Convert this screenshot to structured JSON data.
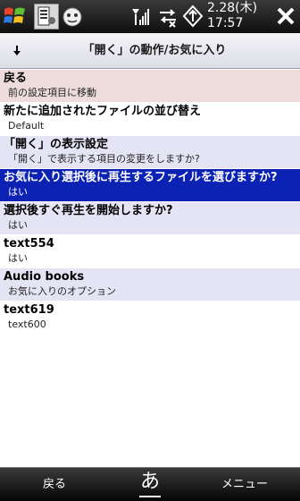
{
  "status": {
    "date": "2.28(木)",
    "time": "17:57"
  },
  "header": {
    "title": "「開く」の動作/お気に入り"
  },
  "colors": {
    "selected": "#0c22b4",
    "row_alt": "#e4e4f4",
    "row_back": "#eedcdc"
  },
  "items": [
    {
      "title": "戻る",
      "subtitle": "前の設定項目に移動"
    },
    {
      "title": "新たに追加されたファイルの並び替え",
      "subtitle": "Default"
    },
    {
      "title": "「開く」の表示設定",
      "subtitle": "「開く」で表示する項目の変更をしますか?"
    },
    {
      "title": "お気に入り選択後に再生するファイルを選びますか?",
      "subtitle": "はい"
    },
    {
      "title": "選択後すぐ再生を開始しますか?",
      "subtitle": "はい"
    },
    {
      "title": "text554",
      "subtitle": "はい"
    },
    {
      "title": "Audio books",
      "subtitle": "お気に入りのオプション"
    },
    {
      "title": "text619",
      "subtitle": "text600"
    }
  ],
  "softkeys": {
    "left": "戻る",
    "ime": "あ",
    "right": "メニュー"
  },
  "icons": [
    "windows-start-icon",
    "settings-app-icon",
    "media-app-icon",
    "signal-icon",
    "sync-icon",
    "data-icon",
    "close-icon",
    "down-arrow-icon",
    "ime-icon"
  ]
}
